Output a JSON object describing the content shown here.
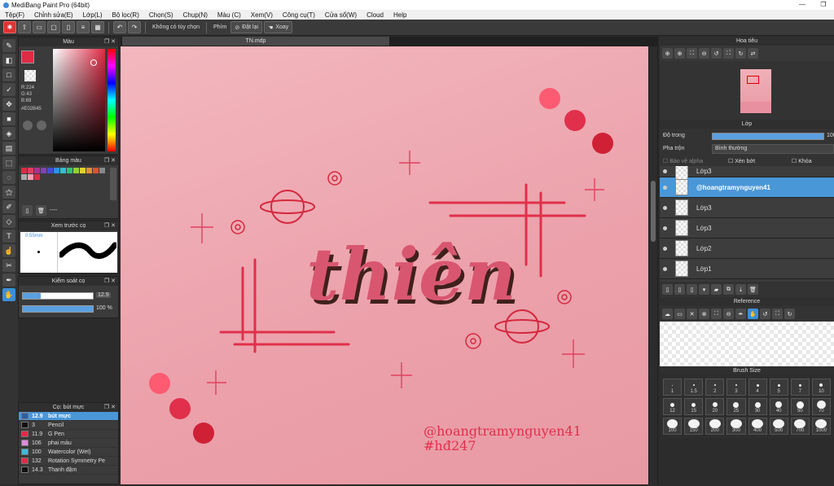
{
  "app": {
    "title": "MediBang Paint Pro (64bit)"
  },
  "menu": [
    "Tệp(F)",
    "Chỉnh sửa(E)",
    "Lớp(L)",
    "Bộ lọc(R)",
    "Chọn(S)",
    "Chụp(N)",
    "Màu (C)",
    "Xem(V)",
    "Công cụ(T)",
    "Cửa sổ(W)",
    "Cloud",
    "Help"
  ],
  "toolbar": {
    "no_select": "Không có tùy chọn",
    "keys": "Phím",
    "reset": "Đặt lại",
    "rotate": "Xoay"
  },
  "document": {
    "tab": "TN.mdp"
  },
  "color_panel": {
    "title": "Màu",
    "r": "R:224",
    "g": "G:43",
    "b": "B:69",
    "hex": "#E02B45",
    "primary": "#E02B45"
  },
  "palette_panel": {
    "title": "Bảng màu",
    "dash": "----",
    "colors": [
      "#e02b45",
      "#e04060",
      "#b03090",
      "#8040c0",
      "#4050d0",
      "#3090e0",
      "#30c0d0",
      "#30c070",
      "#90d030",
      "#e0d030",
      "#e09030",
      "#e05030",
      "#888",
      "#aaa",
      "#ff9fb0",
      "#e02b45"
    ]
  },
  "preview_panel": {
    "title": "Xem trước cọ",
    "size": "0.55mm"
  },
  "brush_control": {
    "title": "Kiểm soát cọ",
    "size": "12.9",
    "opacity": "100 %"
  },
  "brush_list": {
    "title": "Cọ: bút mực",
    "items": [
      {
        "size": "12.9",
        "name": "bút mực",
        "color": "#2b5fa8"
      },
      {
        "size": "3",
        "name": "Pencil",
        "color": "#111"
      },
      {
        "size": "11.9",
        "name": "G Pen",
        "color": "#e02b45"
      },
      {
        "size": "106",
        "name": "phai màu",
        "color": "#e08ae0"
      },
      {
        "size": "100",
        "name": "Watercolor (Wet)",
        "color": "#40b8e0"
      },
      {
        "size": "132",
        "name": "Rotation Symmetry Pe",
        "color": "#e02b45"
      },
      {
        "size": "14.3",
        "name": "Thanh đậm",
        "color": "#111"
      }
    ]
  },
  "navigator": {
    "title": "Hoa tiêu"
  },
  "layers": {
    "title": "Lớp",
    "opacity_label": "Độ trong",
    "opacity_value": "100",
    "blend_label": "Pha trộn",
    "blend_value": "Bình thường",
    "protect_alpha": "Bảo vệ alpha",
    "clip": "Xén bớt",
    "lock": "Khóa",
    "items": [
      {
        "name": "Lớp3",
        "selected": false
      },
      {
        "name": "@hoangtramynguyen41",
        "selected": true
      },
      {
        "name": "Lớp3",
        "selected": false
      },
      {
        "name": "Lớp3",
        "selected": false
      },
      {
        "name": "Lớp2",
        "selected": false
      },
      {
        "name": "Lớp1",
        "selected": false
      }
    ]
  },
  "reference": {
    "title": "Reference"
  },
  "brush_size": {
    "title": "Brush Size",
    "sizes": [
      "1",
      "1.5",
      "2",
      "3",
      "4",
      "5",
      "7",
      "10",
      "12",
      "15",
      "20",
      "25",
      "30",
      "40",
      "50",
      "70",
      "100",
      "150",
      "200",
      "300",
      "400",
      "500",
      "700",
      "1000"
    ]
  },
  "artwork": {
    "title_text": "thiên",
    "handle": "@hoangtramynguyen41",
    "tag": "#hđ247"
  }
}
